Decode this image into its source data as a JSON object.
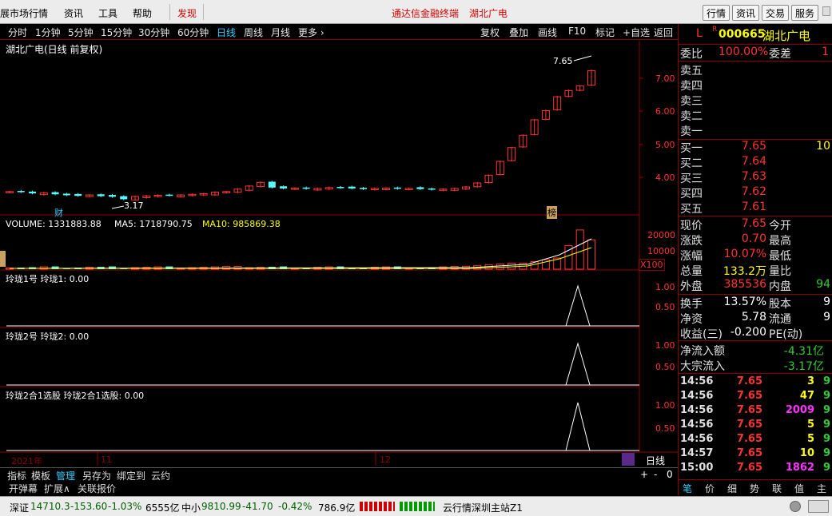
{
  "menubar": {
    "items": [
      "展市场行情",
      "资讯",
      "工具",
      "帮助",
      "发现"
    ],
    "center": [
      "通达信金融终端",
      "湖北广电"
    ],
    "right_buttons": [
      "行情",
      "资讯",
      "交易",
      "服务"
    ]
  },
  "periods": [
    "分时",
    "1分钟",
    "5分钟",
    "15分钟",
    "30分钟",
    "60分钟",
    "日线",
    "周线",
    "月线",
    "更多 ›"
  ],
  "toolbar_right": [
    "复权",
    "叠加",
    "画线",
    "F10",
    "标记",
    "+自选",
    "返回"
  ],
  "chart": {
    "title": "湖北广电(日线 前复权)",
    "price_ticks": [
      "7.00",
      "6.00",
      "5.00",
      "4.00"
    ],
    "high_label": "7.65",
    "low_label": "3.17",
    "markers": [
      "财",
      "榜"
    ],
    "volume_header": {
      "vol": "VOLUME: 1331883.88",
      "ma5": "MA5: 1718790.75",
      "ma10": "MA10: 985869.38"
    },
    "volume_ticks": [
      "20000",
      "10000"
    ],
    "volume_unit": "X100",
    "ind1_header": "玲珑1号  玲珑1: 0.00",
    "ind2_header": "玲珑2号  玲珑2: 0.00",
    "ind3_header": "玲珑2合1选股  玲珑2合1选股: 0.00",
    "ind_ticks": [
      "1.00",
      "0.50"
    ],
    "date_labels": [
      "2021年",
      "11",
      "12"
    ],
    "period_tag": "日线",
    "zoom_btns": [
      "+",
      "-",
      "0"
    ]
  },
  "chart_data": {
    "type": "candlestick",
    "title": "湖北广电(日线 前复权)",
    "high_marker": 7.65,
    "low_marker": 3.17,
    "series": [
      {
        "name": "price",
        "values": [
          3.42,
          3.4,
          3.36,
          3.38,
          3.33,
          3.3,
          3.28,
          3.31,
          3.27,
          3.25,
          3.17,
          3.26,
          3.28,
          3.3,
          3.29,
          3.31,
          3.33,
          3.35,
          3.4,
          3.42,
          3.5,
          3.6,
          3.72,
          3.55,
          3.52,
          3.53,
          3.51,
          3.52,
          3.55,
          3.54,
          3.52,
          3.5,
          3.52,
          3.53,
          3.51,
          3.52,
          3.5,
          3.48,
          3.5,
          3.52,
          3.57,
          3.7,
          3.95,
          4.4,
          4.85,
          5.25,
          5.75,
          6.05,
          6.5,
          6.7,
          6.85,
          7.35
        ]
      }
    ]
  },
  "stock": {
    "marker": "L",
    "r": "R",
    "code": "000665",
    "name": "湖北广电"
  },
  "quote": {
    "weibi_k": "委比",
    "weibi_v": "100.00%",
    "weicha_k": "委差",
    "weicha_v": "1",
    "sell": [
      "卖五",
      "卖四",
      "卖三",
      "卖二",
      "卖一"
    ],
    "buy": [
      {
        "k": "买一",
        "p": "7.65",
        "q": "10"
      },
      {
        "k": "买二",
        "p": "7.64",
        "q": ""
      },
      {
        "k": "买三",
        "p": "7.63",
        "q": ""
      },
      {
        "k": "买四",
        "p": "7.62",
        "q": ""
      },
      {
        "k": "买五",
        "p": "7.61",
        "q": ""
      }
    ],
    "stats": [
      {
        "k": "现价",
        "v": "7.65",
        "c": "red",
        "k2": "今开",
        "v2": ""
      },
      {
        "k": "涨跌",
        "v": "0.70",
        "c": "red",
        "k2": "最高",
        "v2": ""
      },
      {
        "k": "涨幅",
        "v": "10.07%",
        "c": "red",
        "k2": "最低",
        "v2": ""
      },
      {
        "k": "总量",
        "v": "133.2万",
        "c": "yellow",
        "k2": "量比",
        "v2": ""
      },
      {
        "k": "外盘",
        "v": "385536",
        "c": "red",
        "k2": "内盘",
        "v2": "94"
      }
    ],
    "stats2": [
      {
        "k": "换手",
        "v": "13.57%",
        "c": "white",
        "k2": "股本",
        "v2": "9"
      },
      {
        "k": "净资",
        "v": "5.78",
        "c": "white",
        "k2": "流通",
        "v2": "9"
      },
      {
        "k": "收益(三)",
        "v": "-0.200",
        "c": "white",
        "k2": "PE(动)",
        "v2": ""
      }
    ],
    "flow": [
      {
        "k": "净流入额",
        "v": "-4.31亿"
      },
      {
        "k": "大宗流入",
        "v": "-3.17亿"
      }
    ],
    "ticks": [
      {
        "t": "14:56",
        "p": "7.65",
        "q": "3",
        "qc": "yellow",
        "x": "9"
      },
      {
        "t": "14:56",
        "p": "7.65",
        "q": "47",
        "qc": "yellow",
        "x": "9"
      },
      {
        "t": "14:56",
        "p": "7.65",
        "q": "2009",
        "qc": "magenta",
        "x": "9"
      },
      {
        "t": "14:56",
        "p": "7.65",
        "q": "5",
        "qc": "yellow",
        "x": "9"
      },
      {
        "t": "14:56",
        "p": "7.65",
        "q": "5",
        "qc": "yellow",
        "x": "9"
      },
      {
        "t": "14:57",
        "p": "7.65",
        "q": "10",
        "qc": "yellow",
        "x": "9"
      },
      {
        "t": "15:00",
        "p": "7.65",
        "q": "1862",
        "qc": "magenta",
        "x": "9"
      }
    ],
    "bottom_tabs": [
      "笔",
      "价",
      "细",
      "势",
      "联",
      "值",
      "主"
    ]
  },
  "bottom_tabs": [
    "指标",
    "模板",
    "管理",
    "另存为",
    "绑定到",
    "云约"
  ],
  "bottom_tabs2": [
    "开弹幕",
    "扩展∧",
    "关联报价"
  ],
  "status": {
    "sz_name": "深证",
    "sz_val": "14710.3",
    "sz_chg": "-153.60",
    "sz_pct": "-1.03%",
    "sz_amt": "6555亿",
    "zx_name": "中小",
    "zx_val": "9810.99",
    "zx_chg": "-41.70",
    "zx_pct": "-0.42%",
    "zx_amt": "786.9亿",
    "server": "云行情深圳主站Z1"
  }
}
